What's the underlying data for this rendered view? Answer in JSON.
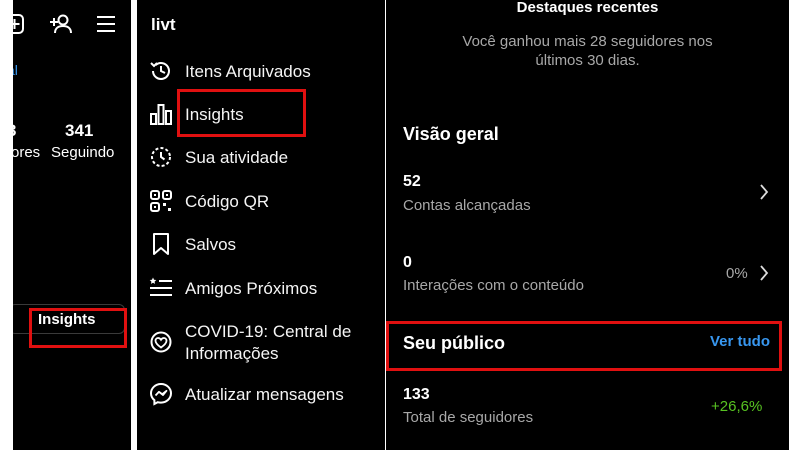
{
  "profile_panel": {
    "link_fragment": "al",
    "stat_followers_value": "3",
    "stat_followers_label": "ores",
    "stat_following_value": "341",
    "stat_following_label": "Seguindo",
    "insights_button_label": "Insights"
  },
  "menu": {
    "username": "livt",
    "items": [
      {
        "label": "Itens Arquivados",
        "icon": "history-icon"
      },
      {
        "label": "Insights",
        "icon": "bar-chart-icon"
      },
      {
        "label": "Sua atividade",
        "icon": "activity-icon"
      },
      {
        "label": "Código QR",
        "icon": "qr-code-icon"
      },
      {
        "label": "Salvos",
        "icon": "bookmark-icon"
      },
      {
        "label": "Amigos Próximos",
        "icon": "close-friends-icon"
      },
      {
        "label": "COVID-19: Central de",
        "label2": "Informações",
        "icon": "covid-info-icon"
      },
      {
        "label": "Atualizar mensagens",
        "icon": "messenger-icon"
      }
    ]
  },
  "insights": {
    "highlights_title": "Destaques recentes",
    "highlights_text_line1": "Você ganhou mais 28 seguidores nos",
    "highlights_text_line2": "últimos 30 dias.",
    "overview_title": "Visão geral",
    "accounts_reached_value": "52",
    "accounts_reached_label": "Contas alcançadas",
    "interactions_value": "0",
    "interactions_label": "Interações com o conteúdo",
    "interactions_change": "0%",
    "audience_title": "Seu público",
    "see_all_label": "Ver tudo",
    "followers_total_value": "133",
    "followers_total_label": "Total de seguidores",
    "followers_change": "+26,6%"
  },
  "colors": {
    "background": "#000000",
    "highlight_box": "#e01010",
    "link_blue": "#3897f0",
    "positive_green": "#58c322",
    "muted_text": "#a8a8a8"
  }
}
